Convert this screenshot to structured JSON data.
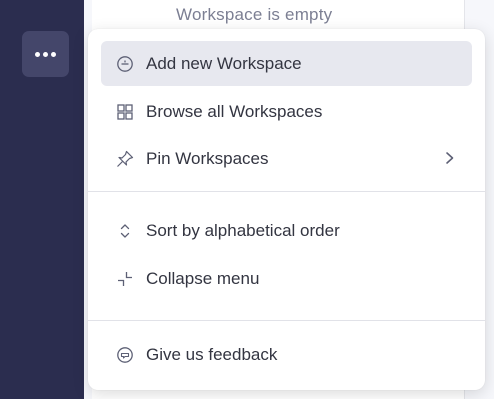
{
  "sidebar": {
    "more_button_icon": "more-dots-icon"
  },
  "background": {
    "empty_message": "Workspace is empty"
  },
  "menu": {
    "groups": [
      {
        "items": [
          {
            "label": "Add new Workspace",
            "icon": "add-circle-icon",
            "highlighted": true
          },
          {
            "label": "Browse all Workspaces",
            "icon": "grid-icon"
          },
          {
            "label": "Pin Workspaces",
            "icon": "pin-icon",
            "submenu": true
          }
        ]
      },
      {
        "items": [
          {
            "label": "Sort by alphabetical order",
            "icon": "sort-icon"
          },
          {
            "label": "Collapse menu",
            "icon": "collapse-icon"
          }
        ]
      },
      {
        "items": [
          {
            "label": "Give us feedback",
            "icon": "feedback-icon"
          }
        ]
      }
    ]
  },
  "colors": {
    "sidebar": "#2b2d4f",
    "highlight": "#e7e8ef",
    "text": "#333541"
  }
}
